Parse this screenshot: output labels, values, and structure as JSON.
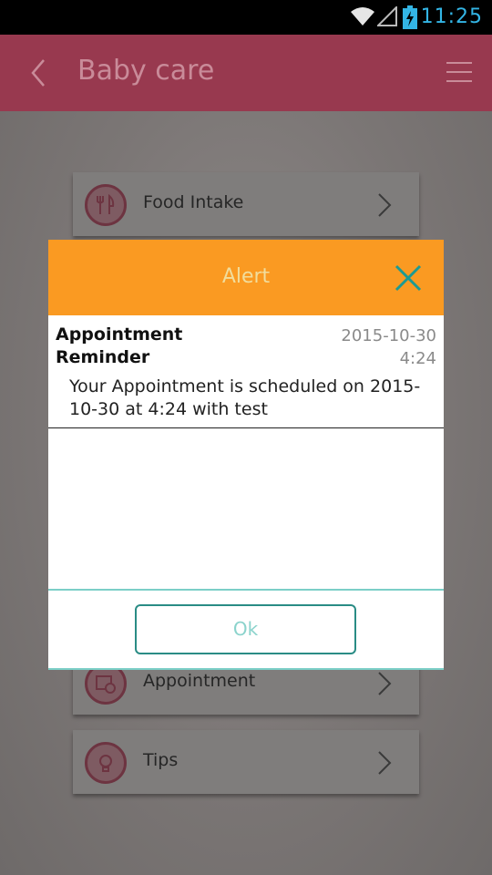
{
  "status_bar": {
    "time": "11:25"
  },
  "app_bar": {
    "title": "Baby care",
    "back_icon": "chevron-left-icon",
    "menu_icon": "hamburger-menu-icon"
  },
  "menu": {
    "items": [
      {
        "label": "Food Intake",
        "icon": "fork-knife-icon"
      },
      {
        "label": "Appointment",
        "icon": "calendar-clock-icon"
      },
      {
        "label": "Tips",
        "icon": "lightbulb-icon"
      }
    ]
  },
  "dialog": {
    "title": "Alert",
    "close_icon": "close-icon",
    "message_title": "Appointment Reminder",
    "message_date": "2015-10-30",
    "message_time": "4:24",
    "message_body": "Your Appointment is scheduled on 2015-10-30 at 4:24 with test",
    "ok_label": "Ok"
  },
  "colors": {
    "app_bar": "#98394f",
    "dialog_header": "#fa9a22",
    "accent_teal": "#2a8c85",
    "status_text": "#33b5e5"
  }
}
